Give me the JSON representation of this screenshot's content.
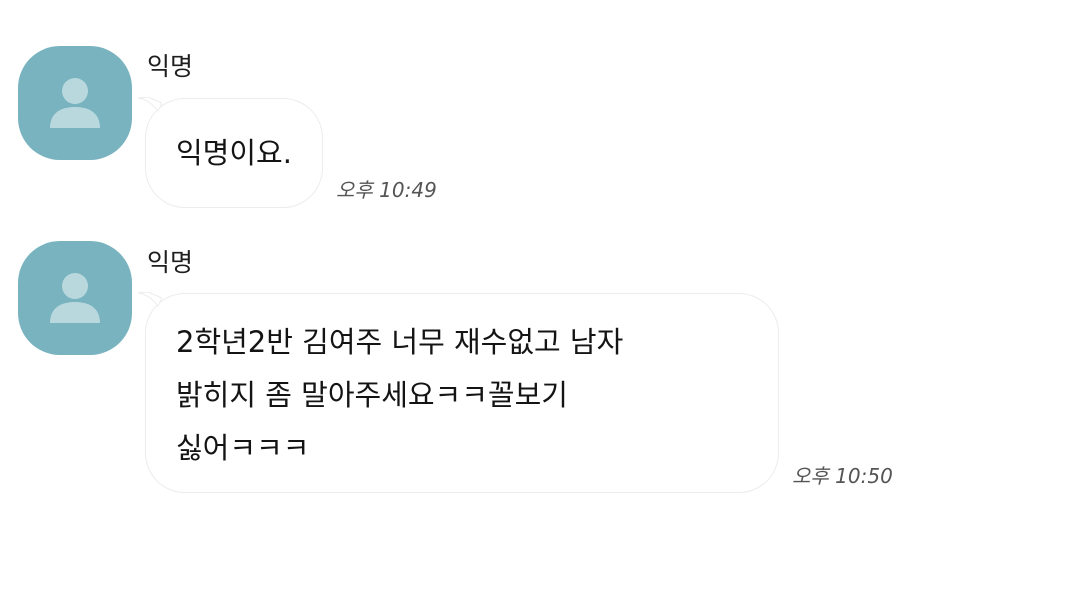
{
  "messages": [
    {
      "sender": "익명",
      "text": "익명이요.",
      "time": "오후 10:49",
      "avatar_icon": "default-person-icon"
    },
    {
      "sender": "익명",
      "text": "2학년2반 김여주 너무 재수없고 남자\n밝히지 좀 말아주세요ㅋㅋ꼴보기\n싫어ㅋㅋㅋ",
      "time": "오후 10:50",
      "avatar_icon": "default-person-icon"
    }
  ],
  "colors": {
    "avatar_bg": "#78b3bf",
    "avatar_figure": "#b9d8de",
    "bubble_bg": "#ffffff",
    "bubble_border": "#ececec",
    "background": "#ffffff"
  }
}
